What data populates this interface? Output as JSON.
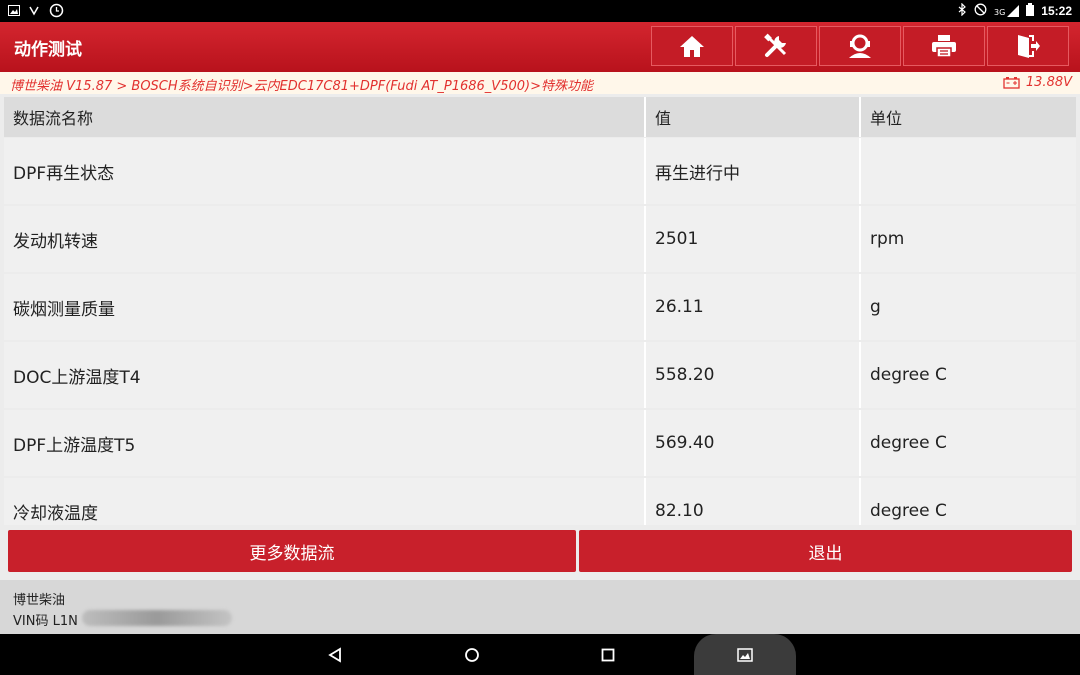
{
  "status_bar": {
    "time": "15:22",
    "network": "3G"
  },
  "header": {
    "title": "动作测试",
    "buttons": [
      "home-icon",
      "tools-icon",
      "user-service-icon",
      "print-icon",
      "exit-icon"
    ]
  },
  "breadcrumb": {
    "path": "博世柴油 V15.87 > BOSCH系统自识别>云内EDC17C81+DPF(Fudi AT_P1686_V500)>特殊功能",
    "voltage": "13.88V"
  },
  "table": {
    "headers": [
      "数据流名称",
      "值",
      "单位"
    ],
    "rows": [
      {
        "name": "DPF再生状态",
        "value": "再生进行中",
        "unit": ""
      },
      {
        "name": "发动机转速",
        "value": "2501",
        "unit": "rpm"
      },
      {
        "name": "碳烟测量质量",
        "value": "26.11",
        "unit": "g"
      },
      {
        "name": "DOC上游温度T4",
        "value": "558.20",
        "unit": "degree C"
      },
      {
        "name": "DPF上游温度T5",
        "value": "569.40",
        "unit": "degree C"
      },
      {
        "name": "冷却液温度",
        "value": "82.10",
        "unit": "degree C"
      }
    ]
  },
  "actions": {
    "more": "更多数据流",
    "exit": "退出"
  },
  "footer": {
    "line1": "博世柴油",
    "line2": "VIN码 L1N"
  },
  "colors": {
    "brand_red": "#c41c26",
    "accent_text": "#e2312f"
  }
}
